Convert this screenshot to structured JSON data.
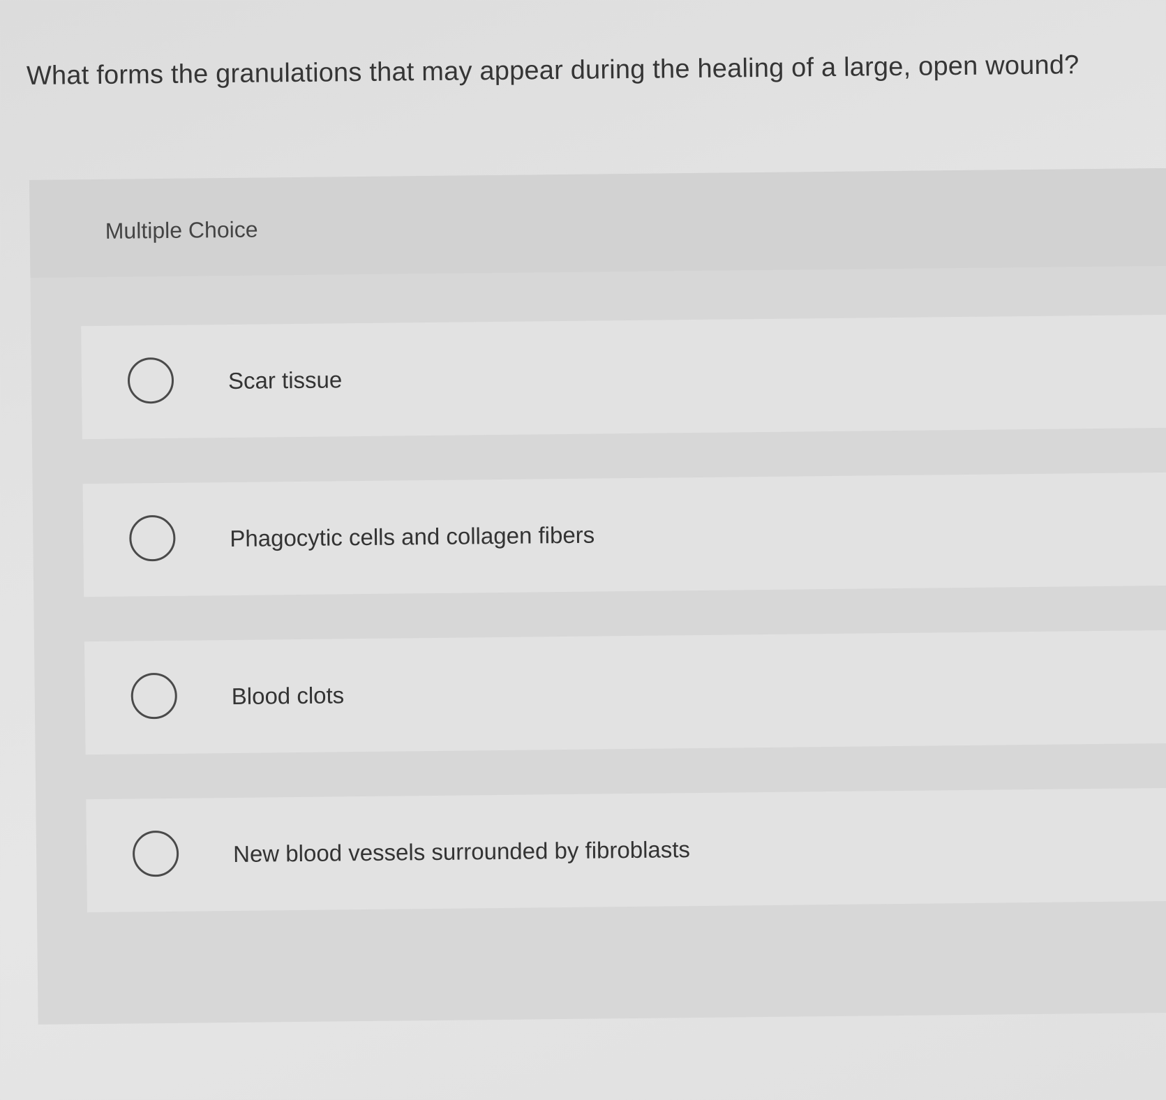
{
  "question": {
    "text": "What forms the granulations that may appear during the healing of a large, open wound?"
  },
  "multiple_choice": {
    "label": "Multiple Choice",
    "options": [
      {
        "label": "Scar tissue",
        "selected": false
      },
      {
        "label": "Phagocytic cells and collagen fibers",
        "selected": false
      },
      {
        "label": "Blood clots",
        "selected": false
      },
      {
        "label": "New blood vessels surrounded by fibroblasts",
        "selected": false
      }
    ]
  },
  "colors": {
    "background": "#e3e3e3",
    "panel": "#d7d7d7",
    "option_background": "#e2e2e2",
    "text": "#353535",
    "radio_border": "#4a4a4a"
  }
}
